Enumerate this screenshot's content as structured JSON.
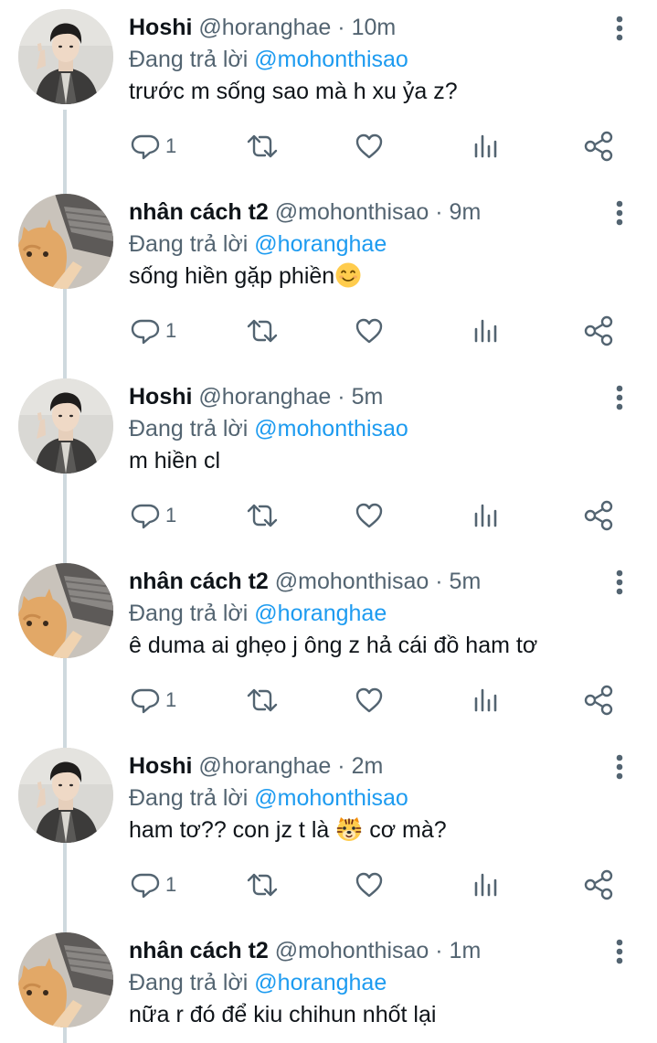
{
  "reply_prefix": "Đang trả lời",
  "colors": {
    "text": "#0f1419",
    "muted": "#536471",
    "mention": "#1d9bf0",
    "thread_line": "#cfd9de"
  },
  "icons": [
    "reply-icon",
    "retweet-icon",
    "like-icon",
    "views-icon",
    "share-icon",
    "more-icon",
    "smiling-face-emoji",
    "tiger-face-emoji"
  ],
  "tweets": [
    {
      "name": "Hoshi",
      "handle": "@horanghae",
      "dot": "·",
      "time": "10m",
      "reply_to": "@mohonthisao",
      "text": "trước m sống sao mà h xu ỷa z?",
      "reply_count": "1"
    },
    {
      "name": "nhân cách t2",
      "handle": "@mohonthisao",
      "dot": "·",
      "time": "9m",
      "reply_to": "@horanghae",
      "text": "sống hiền gặp phiền",
      "reply_count": "1"
    },
    {
      "name": "Hoshi",
      "handle": "@horanghae",
      "dot": "·",
      "time": "5m",
      "reply_to": "@mohonthisao",
      "text": "m hiền cl",
      "reply_count": "1"
    },
    {
      "name": "nhân cách t2",
      "handle": "@mohonthisao",
      "dot": "·",
      "time": "5m",
      "reply_to": "@horanghae",
      "text": "ê duma ai ghẹo j ông z hả cái đồ ham tơ",
      "reply_count": "1"
    },
    {
      "name": "Hoshi",
      "handle": "@horanghae",
      "dot": "·",
      "time": "2m",
      "reply_to": "@mohonthisao",
      "text": "ham tơ?? con jz t là",
      "text_after": "cơ mà?",
      "reply_count": "1"
    },
    {
      "name": "nhân cách t2",
      "handle": "@mohonthisao",
      "dot": "·",
      "time": "1m",
      "reply_to": "@horanghae",
      "text": "nữa r đó để kiu chihun nhốt lại"
    }
  ]
}
